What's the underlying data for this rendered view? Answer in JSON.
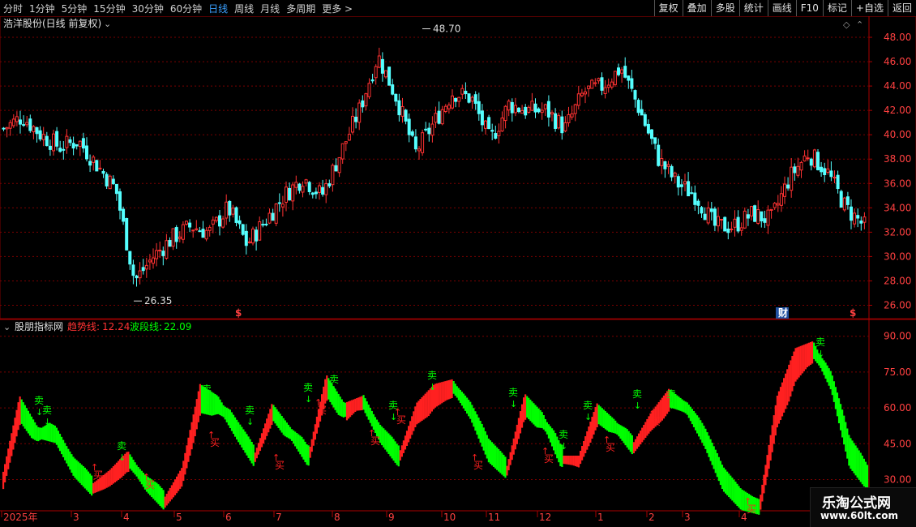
{
  "toolbar": {
    "periods": [
      "分时",
      "1分钟",
      "5分钟",
      "15分钟",
      "30分钟",
      "60分钟",
      "日线",
      "周线",
      "月线",
      "多周期",
      "更多 >"
    ],
    "active_period": "日线",
    "buttons": [
      "复权",
      "叠加",
      "多股",
      "统计",
      "画线",
      "F10",
      "标记",
      "+自选",
      "返回"
    ]
  },
  "main_panel": {
    "title": "浩洋股份(日线 前复权)",
    "high_label": "48.70",
    "low_label": "26.35",
    "y_ticks": [
      "48.00",
      "46.00",
      "44.00",
      "42.00",
      "40.00",
      "38.00",
      "36.00",
      "34.00",
      "32.00",
      "30.00",
      "28.00",
      "26.00"
    ],
    "markers": [
      "$",
      "财",
      "$"
    ]
  },
  "indicator_panel": {
    "title": "股朋指标网",
    "trend_label": "趋势线:",
    "trend_value": "12.24",
    "wave_label": "波段线:",
    "wave_value": "22.09",
    "y_ticks": [
      "90.00",
      "75.00",
      "60.00",
      "45.00",
      "30.00"
    ],
    "sell_label": "卖",
    "buy_label": "买"
  },
  "x_axis": {
    "labels": [
      "2025年",
      "3",
      "4",
      "5",
      "6",
      "7",
      "8",
      "9",
      "10",
      "11",
      "12",
      "1",
      "2",
      "3",
      "4"
    ]
  },
  "watermark": {
    "line1": "乐淘公式网",
    "line2": "www.60lt.com"
  },
  "colors": {
    "up": "#ff3232",
    "down": "#54ffff",
    "grid": "#7a0000",
    "sell": "#00ff00",
    "buy": "#ff2020",
    "active": "#3aa0ff"
  },
  "chart_data": {
    "type": "candlestick",
    "price_range": [
      26.35,
      48.7
    ],
    "indicator_ylim": [
      20,
      95
    ],
    "x_months": [
      "2025年",
      "3",
      "4",
      "5",
      "6",
      "7",
      "8",
      "9",
      "10",
      "11",
      "12",
      "1",
      "2",
      "3",
      "4"
    ],
    "close_anchors": [
      40.5,
      41.5,
      40.0,
      39.0,
      39.5,
      37.5,
      35.5,
      28.0,
      30.0,
      31.5,
      32.5,
      32.0,
      34.0,
      31.0,
      33.0,
      35.0,
      36.5,
      35.0,
      38.5,
      42.0,
      46.5,
      43.0,
      38.5,
      41.0,
      43.5,
      43.0,
      39.5,
      42.5,
      42.0,
      42.0,
      40.5,
      43.5,
      44.0,
      45.5,
      42.0,
      38.0,
      36.0,
      35.0,
      32.5,
      32.5,
      33.5,
      33.0,
      36.5,
      38.5,
      37.0,
      34.0,
      32.5
    ],
    "indicator_anchors": [
      30,
      65,
      52,
      50,
      36,
      28,
      34,
      42,
      30,
      22,
      35,
      70,
      65,
      52,
      40,
      62,
      52,
      40,
      74,
      62,
      65,
      50,
      40,
      62,
      70,
      72,
      60,
      42,
      35,
      66,
      58,
      40,
      40,
      62,
      55,
      45,
      58,
      68,
      62,
      48,
      30,
      22,
      20,
      65,
      85,
      88,
      72,
      40,
      30
    ]
  }
}
